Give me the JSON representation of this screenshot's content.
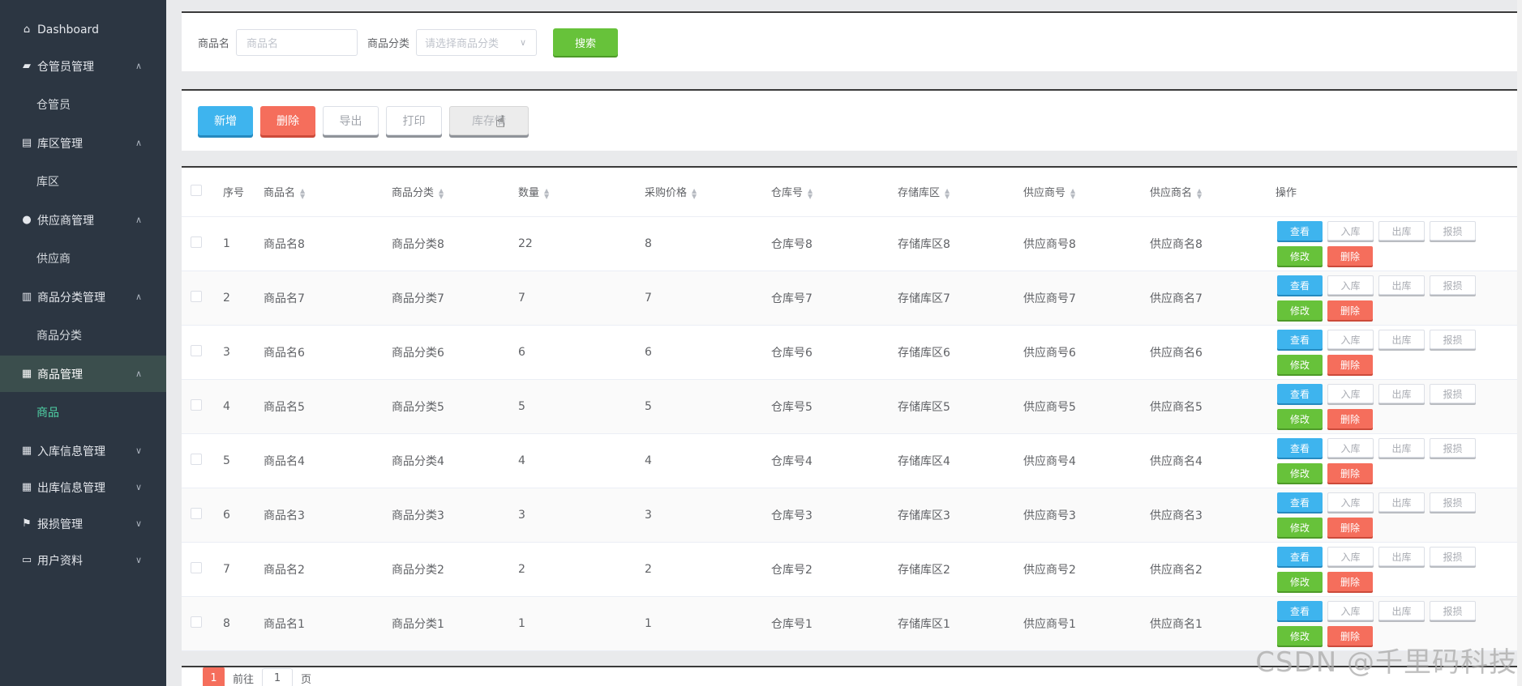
{
  "sidebar": {
    "items": [
      {
        "label": "Dashboard",
        "icon": "home-icon",
        "arrow": ""
      },
      {
        "label": "仓管员管理",
        "icon": "warehouse-icon",
        "arrow": "∧"
      },
      {
        "label": "仓管员",
        "sub": true
      },
      {
        "label": "库区管理",
        "icon": "clipboard-icon",
        "arrow": "∧"
      },
      {
        "label": "库区",
        "sub": true
      },
      {
        "label": "供应商管理",
        "icon": "user-icon",
        "arrow": "∧"
      },
      {
        "label": "供应商",
        "sub": true
      },
      {
        "label": "商品分类管理",
        "icon": "chart-icon",
        "arrow": "∧"
      },
      {
        "label": "商品分类",
        "sub": true
      },
      {
        "label": "商品管理",
        "icon": "grid-icon",
        "arrow": "∧",
        "active": true
      },
      {
        "label": "商品",
        "sub": true,
        "active": true
      },
      {
        "label": "入库信息管理",
        "icon": "grid-icon",
        "arrow": "∨"
      },
      {
        "label": "出库信息管理",
        "icon": "grid-icon",
        "arrow": "∨"
      },
      {
        "label": "报损管理",
        "icon": "flag-icon",
        "arrow": "∨"
      },
      {
        "label": "用户资料",
        "icon": "id-card-icon",
        "arrow": "∨"
      }
    ]
  },
  "search": {
    "name_label": "商品名",
    "name_placeholder": "商品名",
    "category_label": "商品分类",
    "category_placeholder": "请选择商品分类",
    "search_button": "搜索"
  },
  "toolbar": {
    "add": "新增",
    "delete": "删除",
    "export": "导出",
    "print": "打印",
    "stock_detail": "库存情"
  },
  "table": {
    "headers": [
      "序号",
      "商品名",
      "商品分类",
      "数量",
      "采购价格",
      "仓库号",
      "存储库区",
      "供应商号",
      "供应商名",
      "操作"
    ],
    "ops": {
      "view": "查看",
      "in": "入库",
      "out": "出库",
      "loss": "报损",
      "edit": "修改",
      "del": "删除"
    },
    "rows": [
      [
        "1",
        "商品名8",
        "商品分类8",
        "22",
        "8",
        "仓库号8",
        "存储库区8",
        "供应商号8",
        "供应商名8"
      ],
      [
        "2",
        "商品名7",
        "商品分类7",
        "7",
        "7",
        "仓库号7",
        "存储库区7",
        "供应商号7",
        "供应商名7"
      ],
      [
        "3",
        "商品名6",
        "商品分类6",
        "6",
        "6",
        "仓库号6",
        "存储库区6",
        "供应商号6",
        "供应商名6"
      ],
      [
        "4",
        "商品名5",
        "商品分类5",
        "5",
        "5",
        "仓库号5",
        "存储库区5",
        "供应商号5",
        "供应商名5"
      ],
      [
        "5",
        "商品名4",
        "商品分类4",
        "4",
        "4",
        "仓库号4",
        "存储库区4",
        "供应商号4",
        "供应商名4"
      ],
      [
        "6",
        "商品名3",
        "商品分类3",
        "3",
        "3",
        "仓库号3",
        "存储库区3",
        "供应商号3",
        "供应商名3"
      ],
      [
        "7",
        "商品名2",
        "商品分类2",
        "2",
        "2",
        "仓库号2",
        "存储库区2",
        "供应商号2",
        "供应商名2"
      ],
      [
        "8",
        "商品名1",
        "商品分类1",
        "1",
        "1",
        "仓库号1",
        "存储库区1",
        "供应商号1",
        "供应商名1"
      ]
    ]
  },
  "pager": {
    "current": "1",
    "goto_label": "前往",
    "goto_value": "1",
    "page_suffix": "页"
  },
  "watermark": "CSDN @千里码科技",
  "colors": {
    "sidebar": "#2c3642",
    "primary": "#3eb4ee",
    "success": "#67c23a",
    "danger": "#f56e5c",
    "active_text": "#4fd1a5"
  }
}
